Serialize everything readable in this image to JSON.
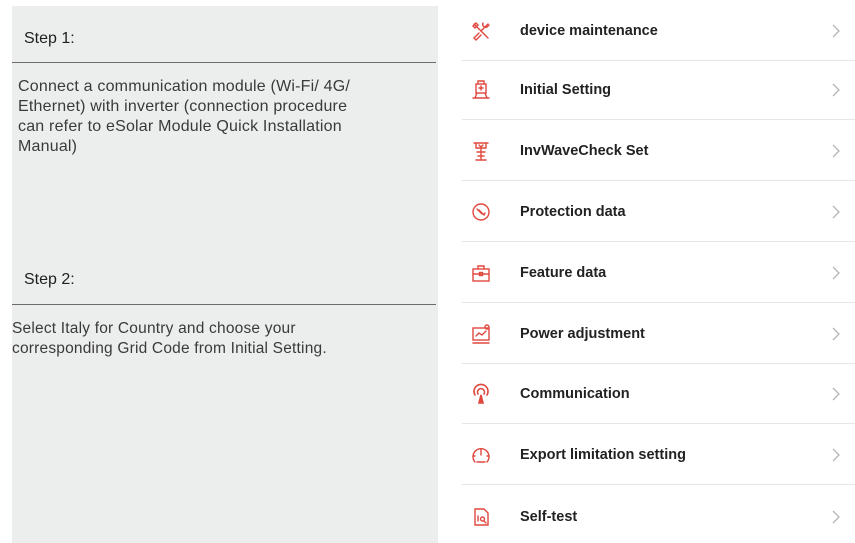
{
  "steps": [
    {
      "title": "Step 1:",
      "body_lines": [
        "Connect a communication module (Wi-Fi/ 4G/",
        "Ethernet) with inverter (connection procedure",
        "can refer to eSolar Module Quick Installation",
        "Manual)"
      ]
    },
    {
      "title": "Step 2:",
      "body_lines": [
        "Select Italy for Country and choose your",
        "corresponding Grid Code from Initial Setting."
      ]
    }
  ],
  "menu": {
    "accent_color": "#e0483e",
    "chevron_color": "#b5b5b5",
    "items": [
      {
        "label": "device maintenance",
        "icon": "tools-icon"
      },
      {
        "label": "Initial Setting",
        "icon": "setting-station-icon"
      },
      {
        "label": "InvWaveCheck Set",
        "icon": "wave-tower-icon"
      },
      {
        "label": "Protection data",
        "icon": "protection-icon"
      },
      {
        "label": "Feature data",
        "icon": "toolbox-icon"
      },
      {
        "label": "Power adjustment",
        "icon": "power-chart-icon"
      },
      {
        "label": "Communication",
        "icon": "signal-icon"
      },
      {
        "label": "Export limitation setting",
        "icon": "gauge-icon"
      },
      {
        "label": "Self-test",
        "icon": "self-test-icon"
      }
    ]
  }
}
